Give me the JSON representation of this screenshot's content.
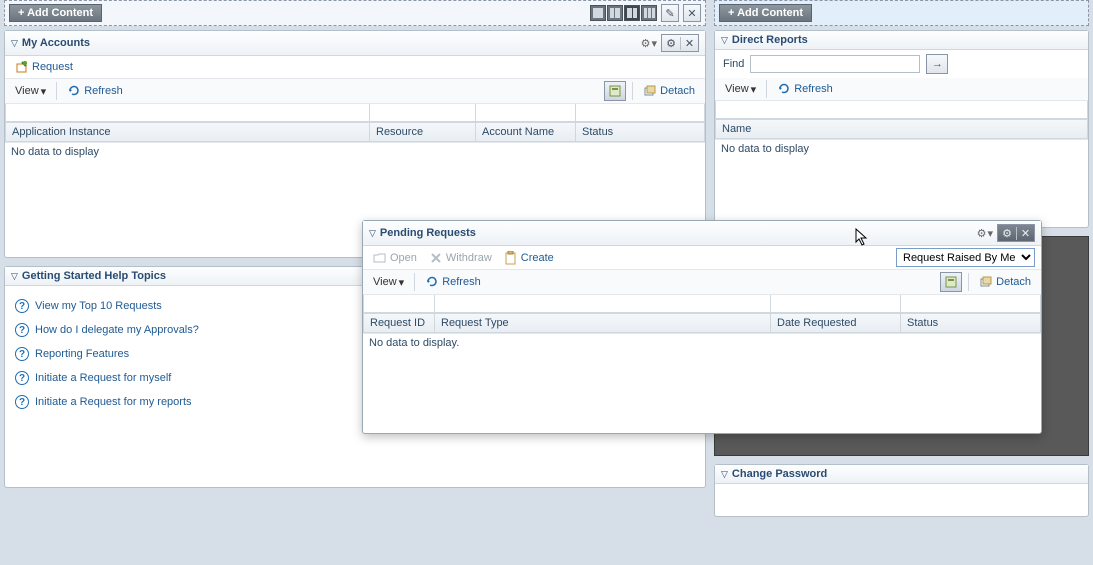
{
  "addContent": "+ Add Content",
  "myAccounts": {
    "title": "My Accounts",
    "request": "Request",
    "view": "View",
    "refresh": "Refresh",
    "detach": "Detach",
    "cols": {
      "appInstance": "Application Instance",
      "resource": "Resource",
      "accountName": "Account Name",
      "status": "Status"
    },
    "empty": "No data to display"
  },
  "helpTopics": {
    "title": "Getting Started Help Topics",
    "items": [
      "View my Top 10 Requests",
      "How do I delegate my Approvals?",
      "Reporting Features",
      "Initiate a Request for myself",
      "Initiate a Request for my reports"
    ]
  },
  "directReports": {
    "title": "Direct Reports",
    "find": "Find",
    "view": "View",
    "refresh": "Refresh",
    "col": "Name",
    "empty": "No data to display"
  },
  "pending": {
    "title": "Pending Requests",
    "open": "Open",
    "withdraw": "Withdraw",
    "create": "Create",
    "filter": "Request Raised By Me",
    "view": "View",
    "refresh": "Refresh",
    "detach": "Detach",
    "cols": {
      "id": "Request ID",
      "type": "Request Type",
      "date": "Date Requested",
      "status": "Status"
    },
    "empty": "No data to display."
  },
  "changePassword": {
    "title": "Change Password"
  }
}
